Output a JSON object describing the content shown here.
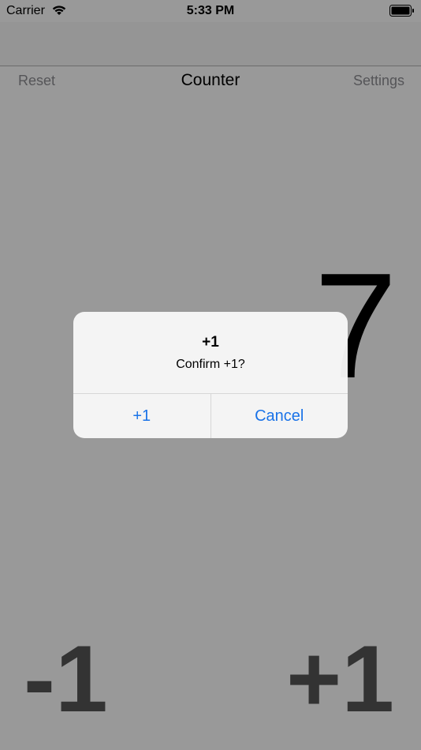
{
  "status_bar": {
    "carrier": "Carrier",
    "time": "5:33 PM",
    "wifi_icon": "wifi-icon",
    "battery_icon": "battery-icon"
  },
  "toolbar": {
    "reset_label": "Reset",
    "title": "Counter",
    "settings_label": "Settings"
  },
  "counter": {
    "value": "7",
    "minus_label": "-1",
    "plus_label": "+1"
  },
  "alert": {
    "title": "+1",
    "message": "Confirm +1?",
    "confirm_label": "+1",
    "cancel_label": "Cancel"
  },
  "colors": {
    "alert_button": "#1a73e8",
    "secondary_text": "#8e8e93",
    "dim_overlay": "#000000"
  }
}
